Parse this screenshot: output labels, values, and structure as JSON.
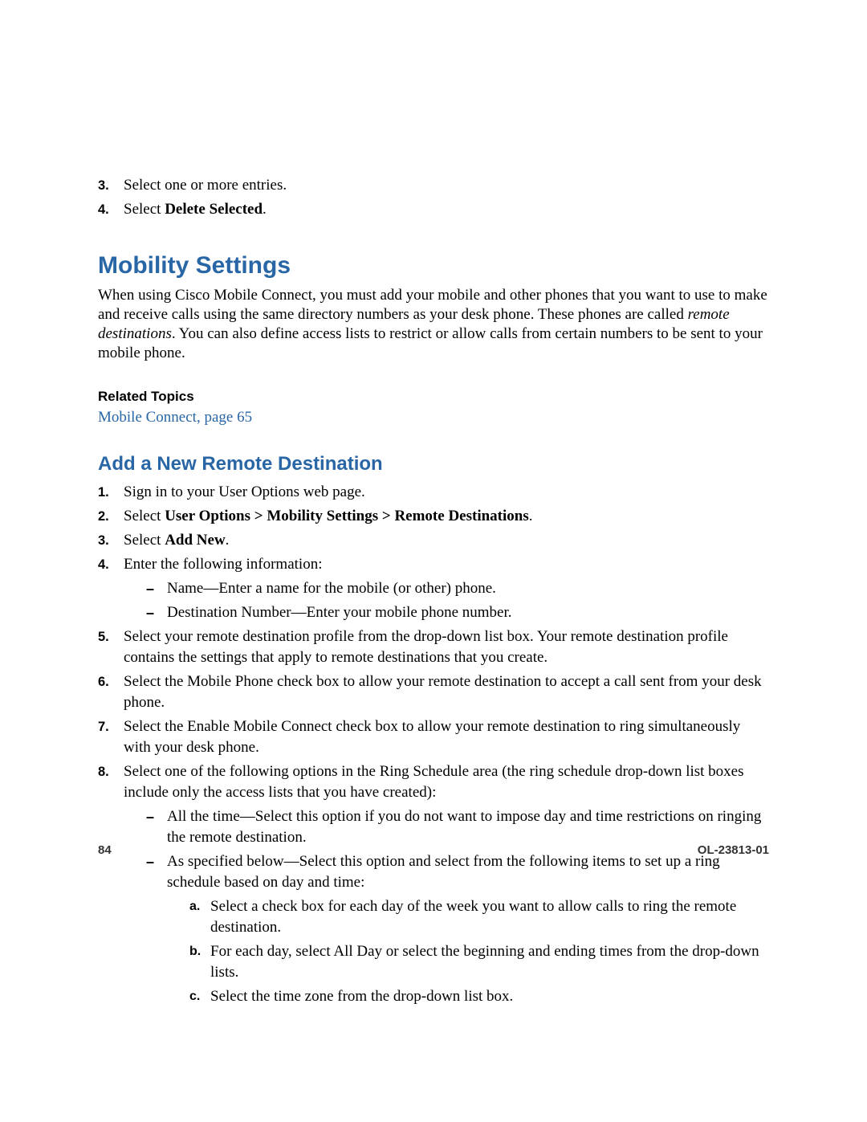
{
  "top_list": {
    "item3_marker": "3.",
    "item3_text": "Select one or more entries.",
    "item4_marker": "4.",
    "item4_prefix": "Select ",
    "item4_bold": "Delete Selected",
    "item4_suffix": "."
  },
  "heading1": "Mobility Settings",
  "intro_before_italic": "When using Cisco Mobile Connect, you must add your mobile and other phones that you want to use to make and receive calls using the same directory numbers as your desk phone. These phones are called ",
  "intro_italic": "remote destinations",
  "intro_after_italic": ". You can also define access lists to restrict or allow calls from certain numbers to be sent to your mobile phone.",
  "related_topics_heading": "Related Topics",
  "related_link": "Mobile Connect, page 65",
  "heading2": "Add a New Remote Destination",
  "steps": {
    "s1_marker": "1.",
    "s1_text": "Sign in to your User Options web page.",
    "s2_marker": "2.",
    "s2_prefix": "Select ",
    "s2_bold": "User Options > Mobility Settings > Remote Destinations",
    "s2_suffix": ".",
    "s3_marker": "3.",
    "s3_prefix": "Select ",
    "s3_bold": "Add New",
    "s3_suffix": ".",
    "s4_marker": "4.",
    "s4_text": "Enter the following information:",
    "s4_sub1": "Name—Enter a name for the mobile (or other) phone.",
    "s4_sub2": "Destination Number—Enter your mobile phone number.",
    "s5_marker": "5.",
    "s5_text": "Select your remote destination profile from the drop-down list box. Your remote destination profile contains the settings that apply to remote destinations that you create.",
    "s6_marker": "6.",
    "s6_text": "Select the Mobile Phone check box to allow your remote destination to accept a call sent from your desk phone.",
    "s7_marker": "7.",
    "s7_text": "Select the Enable Mobile Connect check box to allow your remote destination to ring simultaneously with your desk phone.",
    "s8_marker": "8.",
    "s8_text": "Select one of the following options in the Ring Schedule area (the ring schedule drop-down list boxes include only the access lists that you have created):",
    "s8_sub1": "All the time—Select this option if you do not want to impose day and time restrictions on ringing the remote destination.",
    "s8_sub2": "As specified below—Select this option and select from the following items to set up a ring schedule based on day and time:",
    "s8_sub2_a_marker": "a.",
    "s8_sub2_a": "Select a check box for each day of the week you want to allow calls to ring the remote destination.",
    "s8_sub2_b_marker": "b.",
    "s8_sub2_b": "For each day, select All Day or select the beginning and ending times from the drop-down lists.",
    "s8_sub2_c_marker": "c.",
    "s8_sub2_c": "Select the time zone from the drop-down list box."
  },
  "footer": {
    "page": "84",
    "docid": "OL-23813-01"
  }
}
